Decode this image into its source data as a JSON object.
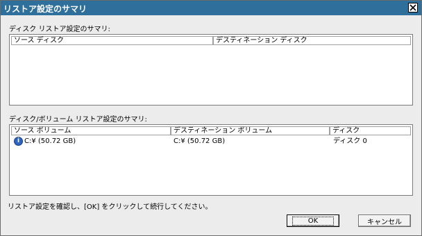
{
  "window": {
    "title": "リストア設定のサマリ"
  },
  "disk_section": {
    "label": "ディスク リストア設定のサマリ:",
    "columns": [
      "ソース ディスク",
      "デスティネーション ディスク"
    ]
  },
  "volume_section": {
    "label": "ディスク/ボリューム リストア設定のサマリ:",
    "columns": [
      "ソース ボリューム",
      "デスティネーション ボリューム",
      "ディスク"
    ],
    "rows": [
      {
        "source": "C:¥ (50.72 GB)",
        "destination": "C:¥ (50.72 GB)",
        "disk": "ディスク 0",
        "icon": "info-icon"
      }
    ]
  },
  "instruction": "リストア設定を確認し、[OK] をクリックして続行してください。",
  "buttons": {
    "ok": "OK",
    "cancel": "キャンセル"
  }
}
